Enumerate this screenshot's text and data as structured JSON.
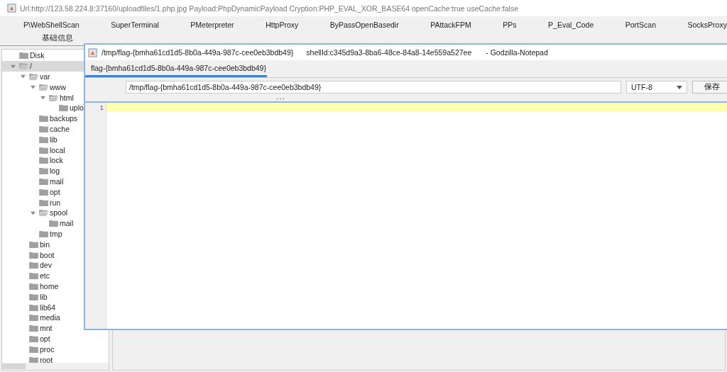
{
  "window": {
    "title": "Url:http://123.58.224.8:37160/uploadfiles/1.php.jpg Payload:PhpDynamicPayload Cryption:PHP_EVAL_XOR_BASE64 openCache:true useCache:false"
  },
  "plugin_tabs": [
    "P\\WebShellScan",
    "SuperTerminal",
    "PMeterpreter",
    "HttpProxy",
    "ByPassOpenBasedir",
    "PAttackFPM",
    "PPs",
    "P_Eval_Code",
    "PortScan",
    "SocksProxy"
  ],
  "function_tabs": [
    "基础信息"
  ],
  "tree": [
    {
      "label": "Disk",
      "expanded": false,
      "selected": false
    },
    {
      "label": "/",
      "expanded": true,
      "selected": true,
      "children": [
        {
          "label": "var",
          "expanded": true,
          "selected": false,
          "children": [
            {
              "label": "www",
              "expanded": true,
              "selected": false,
              "children": [
                {
                  "label": "html",
                  "expanded": true,
                  "selected": false,
                  "children": [
                    {
                      "label": "uplo",
                      "expanded": false,
                      "selected": false
                    }
                  ]
                }
              ]
            },
            {
              "label": "backups",
              "expanded": false,
              "selected": false
            },
            {
              "label": "cache",
              "expanded": false,
              "selected": false
            },
            {
              "label": "lib",
              "expanded": false,
              "selected": false
            },
            {
              "label": "local",
              "expanded": false,
              "selected": false
            },
            {
              "label": "lock",
              "expanded": false,
              "selected": false
            },
            {
              "label": "log",
              "expanded": false,
              "selected": false
            },
            {
              "label": "mail",
              "expanded": false,
              "selected": false
            },
            {
              "label": "opt",
              "expanded": false,
              "selected": false
            },
            {
              "label": "run",
              "expanded": false,
              "selected": false
            },
            {
              "label": "spool",
              "expanded": true,
              "selected": false,
              "children": [
                {
                  "label": "mail",
                  "expanded": false,
                  "selected": false
                }
              ]
            },
            {
              "label": "tmp",
              "expanded": false,
              "selected": false
            }
          ]
        },
        {
          "label": "bin",
          "expanded": false,
          "selected": false
        },
        {
          "label": "boot",
          "expanded": false,
          "selected": false
        },
        {
          "label": "dev",
          "expanded": false,
          "selected": false
        },
        {
          "label": "etc",
          "expanded": false,
          "selected": false
        },
        {
          "label": "home",
          "expanded": false,
          "selected": false
        },
        {
          "label": "lib",
          "expanded": false,
          "selected": false
        },
        {
          "label": "lib64",
          "expanded": false,
          "selected": false
        },
        {
          "label": "media",
          "expanded": false,
          "selected": false
        },
        {
          "label": "mnt",
          "expanded": false,
          "selected": false
        },
        {
          "label": "opt",
          "expanded": false,
          "selected": false
        },
        {
          "label": "proc",
          "expanded": false,
          "selected": false
        },
        {
          "label": "root",
          "expanded": false,
          "selected": false
        }
      ]
    }
  ],
  "notepad": {
    "title": "/tmp/flag-{bmha61cd1d5-8b0a-449a-987c-cee0eb3bdb49}",
    "shell_id": "shellId:c345d9a3-8ba6-48ce-84a8-14e559a527ee",
    "app_name": "- Godzilla-Notepad",
    "tabs": [
      {
        "label": "flag-{bmha61cd1d5-8b0a-449a-987c-cee0eb3bdb49}",
        "selected": true
      }
    ],
    "path": "/tmp/flag-{bmha61cd1d5-8b0a-449a-987c-cee0eb3bdb49}",
    "encoding": "UTF-8",
    "save_button": "保存",
    "line_numbers": [
      "1"
    ]
  }
}
